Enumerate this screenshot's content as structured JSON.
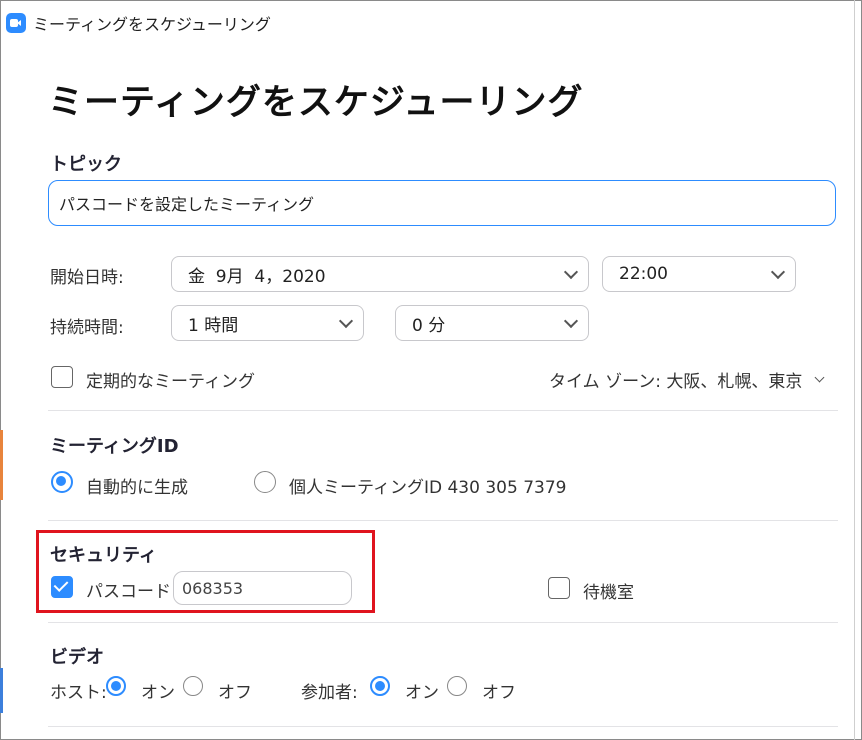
{
  "window": {
    "title": "ミーティングをスケジューリング"
  },
  "heading": "ミーティングをスケジューリング",
  "topic": {
    "label": "トピック",
    "value": "パスコードを設定したミーティング"
  },
  "start": {
    "label": "開始日時:",
    "date": "金  9月  4，2020",
    "time": "22:00"
  },
  "duration": {
    "label": "持続時間:",
    "hours": "1 時間",
    "minutes": "0 分"
  },
  "recurring": {
    "label": "定期的なミーティング",
    "checked": false
  },
  "timezone": {
    "label": "タイム ゾーン: 大阪、札幌、東京"
  },
  "meeting_id": {
    "label": "ミーティングID",
    "options": [
      {
        "label": "自動的に生成",
        "selected": true
      },
      {
        "label": "個人ミーティングID 430 305 7379",
        "selected": false
      }
    ]
  },
  "security": {
    "label": "セキュリティ",
    "passcode": {
      "label": "パスコード",
      "checked": true,
      "value": "068353"
    },
    "waiting_room": {
      "label": "待機室",
      "checked": false
    }
  },
  "video": {
    "label": "ビデオ",
    "host": {
      "label": "ホスト:",
      "on": "オン",
      "off": "オフ",
      "selected": "on"
    },
    "participants": {
      "label": "参加者:",
      "on": "オン",
      "off": "オフ",
      "selected": "on"
    }
  },
  "colors": {
    "accent": "#2d8cff",
    "highlight": "#e0141e"
  }
}
